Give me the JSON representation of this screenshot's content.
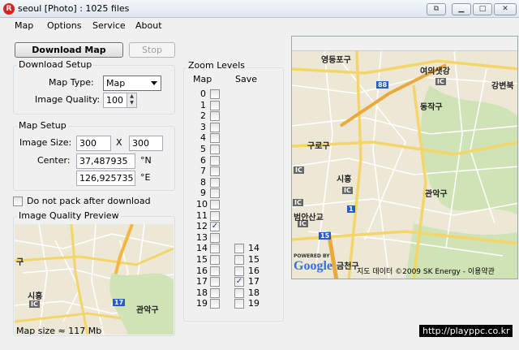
{
  "window": {
    "app_icon": "R",
    "title": "seoul [Photo] : 1025 files",
    "buttons": {
      "extra": "⧉",
      "minimize": "▁",
      "maximize": "□",
      "close": "✕"
    }
  },
  "menu": [
    "Map",
    "Options",
    "Service",
    "About"
  ],
  "toolbar": {
    "download_label": "Download Map",
    "stop_label": "Stop"
  },
  "download_setup": {
    "title": "Download Setup",
    "map_type_label": "Map Type:",
    "map_type_value": "Map",
    "image_quality_label": "Image Quality:",
    "image_quality_value": "100"
  },
  "map_setup": {
    "title": "Map Setup",
    "image_size_label": "Image Size:",
    "width": "300",
    "x_label": "X",
    "height": "300",
    "center_label": "Center:",
    "lat": "37,487935",
    "lat_unit": "°N",
    "lon": "126,925735",
    "lon_unit": "°E"
  },
  "options": {
    "no_pack_label": "Do not pack after download"
  },
  "preview": {
    "title": "Image Quality Preview",
    "labels": [
      "구",
      "시흥",
      "IC",
      "관악구",
      "17"
    ],
    "map_size": "Map size ≈ 117 Mb"
  },
  "zoom": {
    "title": "Zoom Levels",
    "map_header": "Map",
    "save_header": "Save",
    "map_levels": [
      "0",
      "1",
      "2",
      "3",
      "4",
      "5",
      "6",
      "7",
      "8",
      "9",
      "10",
      "11",
      "12",
      "13",
      "14",
      "15",
      "16",
      "17",
      "18",
      "19"
    ],
    "map_checked": [
      12
    ],
    "save_levels": [
      "14",
      "15",
      "16",
      "17",
      "18",
      "19"
    ],
    "save_checked": [
      17
    ]
  },
  "main_map": {
    "labels": [
      "영등포구",
      "여의샛강",
      "IC",
      "88",
      "강변북",
      "동작구",
      "구로구",
      "IC",
      "시흥",
      "IC",
      "관악구",
      "1",
      "IC",
      "IC",
      "범안산교",
      "15",
      "금천구"
    ],
    "powered_by": "POWERED BY",
    "google": "Google",
    "copyright": "지도 데이터 ©2009 SK Energy - 이용약관"
  },
  "watermark": "http://playppc.co.kr"
}
